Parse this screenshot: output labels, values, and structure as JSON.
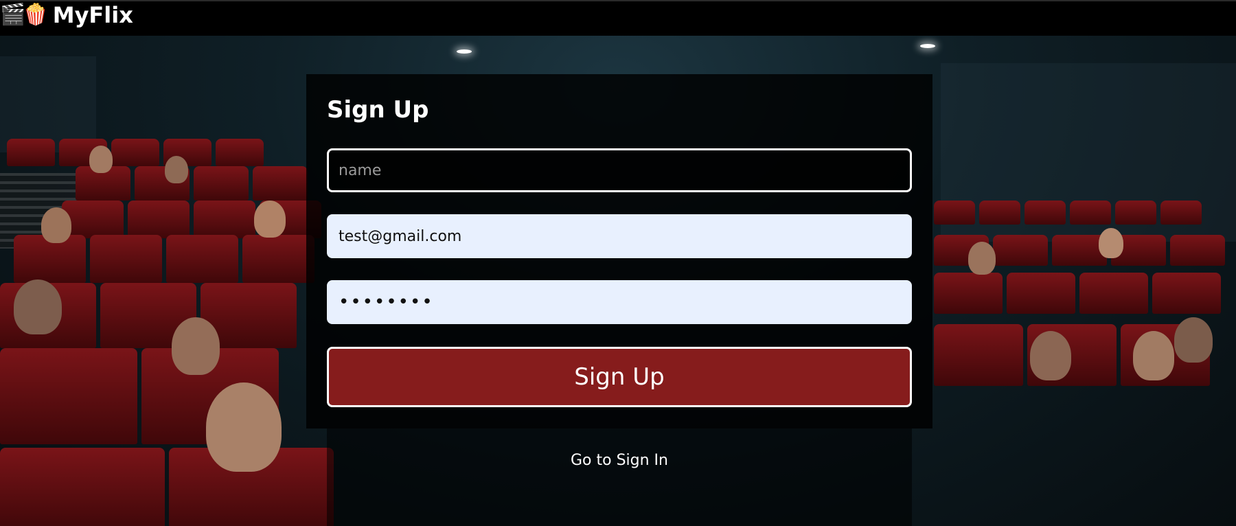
{
  "header": {
    "logo_emoji": "🎬🍿",
    "app_name": "MyFlix"
  },
  "form": {
    "title": "Sign Up",
    "name_placeholder": "name",
    "name_value": "",
    "email_value": "test@gmail.com",
    "password_value": "12345678",
    "submit_label": "Sign Up",
    "signin_link": "Go to Sign In"
  },
  "colors": {
    "header_bg": "#000000",
    "button_bg": "#861c1c",
    "autofill_bg": "#e8f0fe",
    "seat_red": "#7a1418"
  }
}
